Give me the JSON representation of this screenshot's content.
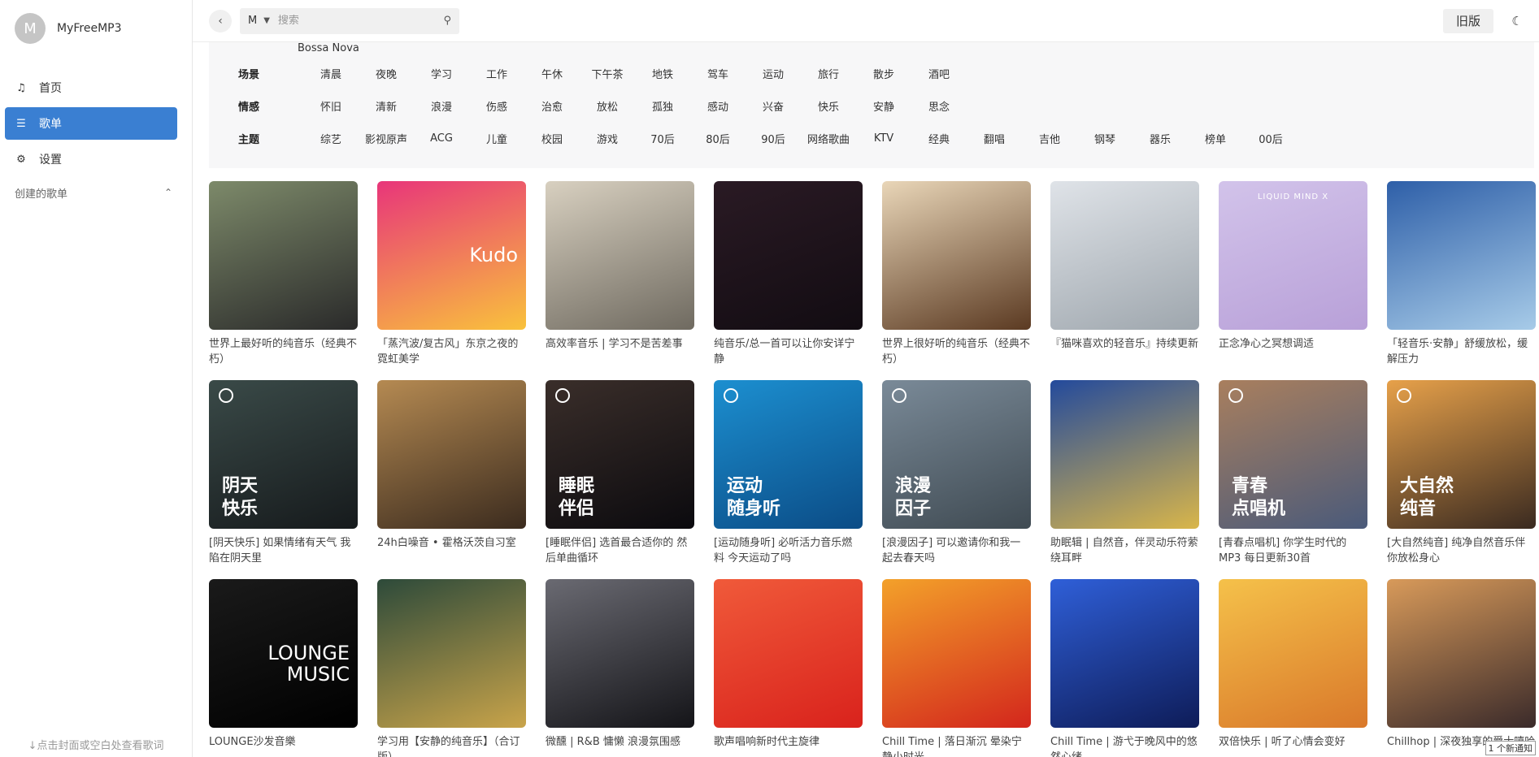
{
  "app": {
    "name": "MyFreeMP3",
    "avatar_letter": "M"
  },
  "sidebar": {
    "items": [
      {
        "label": "首页",
        "icon": "music-note-icon"
      },
      {
        "label": "歌单",
        "icon": "list-icon",
        "active": true
      },
      {
        "label": "设置",
        "icon": "gear-icon"
      }
    ],
    "section_label": "创建的歌单",
    "bottom_tip": "↓点击封面或空白处查看歌词"
  },
  "topbar": {
    "engine": "M",
    "search_placeholder": "搜索",
    "old_version_label": "旧版"
  },
  "filters": {
    "partial_tag": "Bossa Nova",
    "rows": [
      {
        "label": "场景",
        "tags": [
          "清晨",
          "夜晚",
          "学习",
          "工作",
          "午休",
          "下午茶",
          "地铁",
          "驾车",
          "运动",
          "旅行",
          "散步",
          "酒吧"
        ]
      },
      {
        "label": "情感",
        "tags": [
          "怀旧",
          "清新",
          "浪漫",
          "伤感",
          "治愈",
          "放松",
          "孤独",
          "感动",
          "兴奋",
          "快乐",
          "安静",
          "思念"
        ]
      },
      {
        "label": "主题",
        "tags": [
          "综艺",
          "影视原声",
          "ACG",
          "儿童",
          "校园",
          "游戏",
          "70后",
          "80后",
          "90后",
          "网络歌曲",
          "KTV",
          "经典",
          "翻唱",
          "吉他",
          "钢琴",
          "器乐",
          "榜单",
          "00后"
        ]
      }
    ]
  },
  "playlists": [
    {
      "title": "世界上最好听的纯音乐（经典不朽）",
      "colors": [
        "#7d8a6a",
        "#2a2a2a"
      ]
    },
    {
      "title": "「蒸汽波/复古风」东京之夜的霓虹美学",
      "colors": [
        "#e8357a",
        "#f9c23c"
      ],
      "logo": "Kudo"
    },
    {
      "title": "高效率音乐 | 学习不是苦差事",
      "colors": [
        "#d8d0c0",
        "#6f6a60"
      ]
    },
    {
      "title": "纯音乐/总一首可以让你安详宁静",
      "colors": [
        "#2a1a24",
        "#120c12"
      ]
    },
    {
      "title": "世界上很好听的纯音乐（经典不朽）",
      "colors": [
        "#e9d6b8",
        "#5b3a22"
      ]
    },
    {
      "title": "『猫咪喜欢的轻音乐』持续更新",
      "colors": [
        "#dfe3e8",
        "#9ea6ad"
      ]
    },
    {
      "title": "正念净心之冥想调适",
      "colors": [
        "#d2c3ea",
        "#b8a0d8"
      ],
      "small": "LIQUID MIND X"
    },
    {
      "title": "「轻音乐·安静」舒缓放松，缓解压力",
      "colors": [
        "#2e5fa8",
        "#a7cbe8"
      ]
    },
    {
      "title": "[阴天快乐] 如果情绪有天气 我陷在阴天里",
      "colors": [
        "#3a4a48",
        "#161a1c"
      ],
      "text": [
        "阴天",
        "快乐"
      ],
      "badge": true
    },
    {
      "title": "24h白噪音 • 霍格沃茨自习室",
      "colors": [
        "#b58a52",
        "#3b2b1e"
      ]
    },
    {
      "title": "[睡眠伴侣] 选首最合适你的 然后单曲循环",
      "colors": [
        "#3a2e2a",
        "#0b0a0e"
      ],
      "text": [
        "睡眠",
        "伴侣"
      ],
      "badge": true
    },
    {
      "title": "[运动随身听] 必听活力音乐燃料 今天运动了吗",
      "colors": [
        "#1c8fd0",
        "#0b4c86"
      ],
      "text": [
        "运动",
        "随身听"
      ],
      "badge": true
    },
    {
      "title": "[浪漫因子] 可以邀请你和我一起去春天吗",
      "colors": [
        "#7a8a98",
        "#3f4a52"
      ],
      "text": [
        "浪漫",
        "因子"
      ],
      "badge": true
    },
    {
      "title": "助眠辑 | 自然音，伴灵动乐符萦绕耳畔",
      "colors": [
        "#234a9c",
        "#d9b64a"
      ]
    },
    {
      "title": "[青春点唱机] 你学生时代的MP3 每日更新30首",
      "colors": [
        "#a97f5e",
        "#4a5a7a"
      ],
      "text": [
        "青春",
        "点唱机"
      ],
      "badge": true
    },
    {
      "title": "[大自然纯音] 纯净自然音乐伴你放松身心",
      "colors": [
        "#e7a14a",
        "#3a2a20"
      ],
      "text": [
        "大自然",
        "纯音"
      ],
      "badge": true
    },
    {
      "title": "LOUNGE沙发音樂",
      "colors": [
        "#1a1a1a",
        "#000000"
      ],
      "logo": "LOUNGE MUSIC"
    },
    {
      "title": "学习用【安静的纯音乐】（合订版）",
      "colors": [
        "#2d4a3a",
        "#c9a44a"
      ]
    },
    {
      "title": "微醺 | R&B 慵懒 浪漫氛围感",
      "colors": [
        "#6a6a72",
        "#141418"
      ]
    },
    {
      "title": "歌声唱响新时代主旋律",
      "colors": [
        "#f05a3a",
        "#d9221c"
      ]
    },
    {
      "title": "Chill Time | 落日渐沉 晕染宁静小时光",
      "colors": [
        "#f3a12a",
        "#d3261c"
      ]
    },
    {
      "title": "Chill Time | 游弋于晚风中的悠然心绪",
      "colors": [
        "#2f5fd8",
        "#0e1c58"
      ]
    },
    {
      "title": "双倍快乐 | 听了心情会变好",
      "colors": [
        "#f5c14a",
        "#d9782a"
      ]
    },
    {
      "title": "Chillhop | 深夜独享的爵士嘻哈",
      "colors": [
        "#d89a5a",
        "#3a2a2a"
      ]
    }
  ],
  "toast": "1 个新通知"
}
